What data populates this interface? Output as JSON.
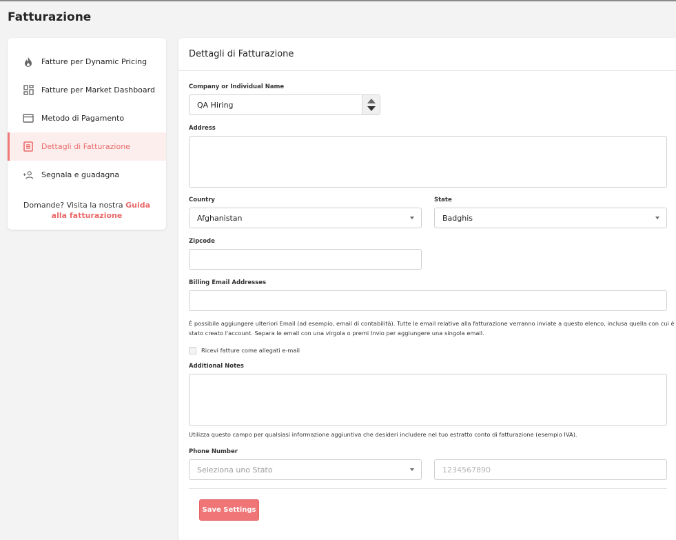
{
  "page": {
    "title": "Fatturazione"
  },
  "sidebar": {
    "items": [
      {
        "label": "Fatture per Dynamic Pricing",
        "icon": "flame-icon"
      },
      {
        "label": "Fatture per Market Dashboard",
        "icon": "dashboard-icon"
      },
      {
        "label": "Metodo di Pagamento",
        "icon": "credit-card-icon"
      },
      {
        "label": "Dettagli di Fatturazione",
        "icon": "document-list-icon",
        "active": true
      },
      {
        "label": "Segnala e guadagna",
        "icon": "add-person-icon"
      }
    ],
    "help_prefix": "Domande? Visita la nostra ",
    "help_link": "Guida alla fatturazione"
  },
  "form": {
    "header": "Dettagli di Fatturazione",
    "company_label": "Company or Individual Name",
    "company_value": "QA Hiring",
    "address_label": "Address",
    "address_value": "",
    "country_label": "Country",
    "country_value": "Afghanistan",
    "state_label": "State",
    "state_value": "Badghis",
    "zipcode_label": "Zipcode",
    "zipcode_value": "",
    "billing_email_label": "Billing Email Addresses",
    "billing_email_value": "",
    "billing_email_help_1": "È possibile aggiungere ulteriori Email (ad esempio, email di contabilità). Tutte le email relative alla fatturazione verranno inviate a questo elenco, inclusa quella con cui è",
    "billing_email_help_2": "stato creato l'account. Separa le email con una virgola o premi Invio per aggiungere una singola email.",
    "attachments_label": "Ricevi fatture come allegati e-mail",
    "attachments_checked": false,
    "notes_label": "Additional Notes",
    "notes_value": "",
    "notes_help": "Utilizza questo campo per qualsiasi informazione aggiuntiva che desideri includere nel tuo estratto conto di fatturazione (esempio IVA).",
    "phone_label": "Phone Number",
    "phone_country_placeholder": "Seleziona uno Stato",
    "phone_placeholder": "1234567890",
    "save_label": "Save Settings"
  },
  "colors": {
    "accent": "#ef7576",
    "active_bg": "#fdeeee"
  }
}
